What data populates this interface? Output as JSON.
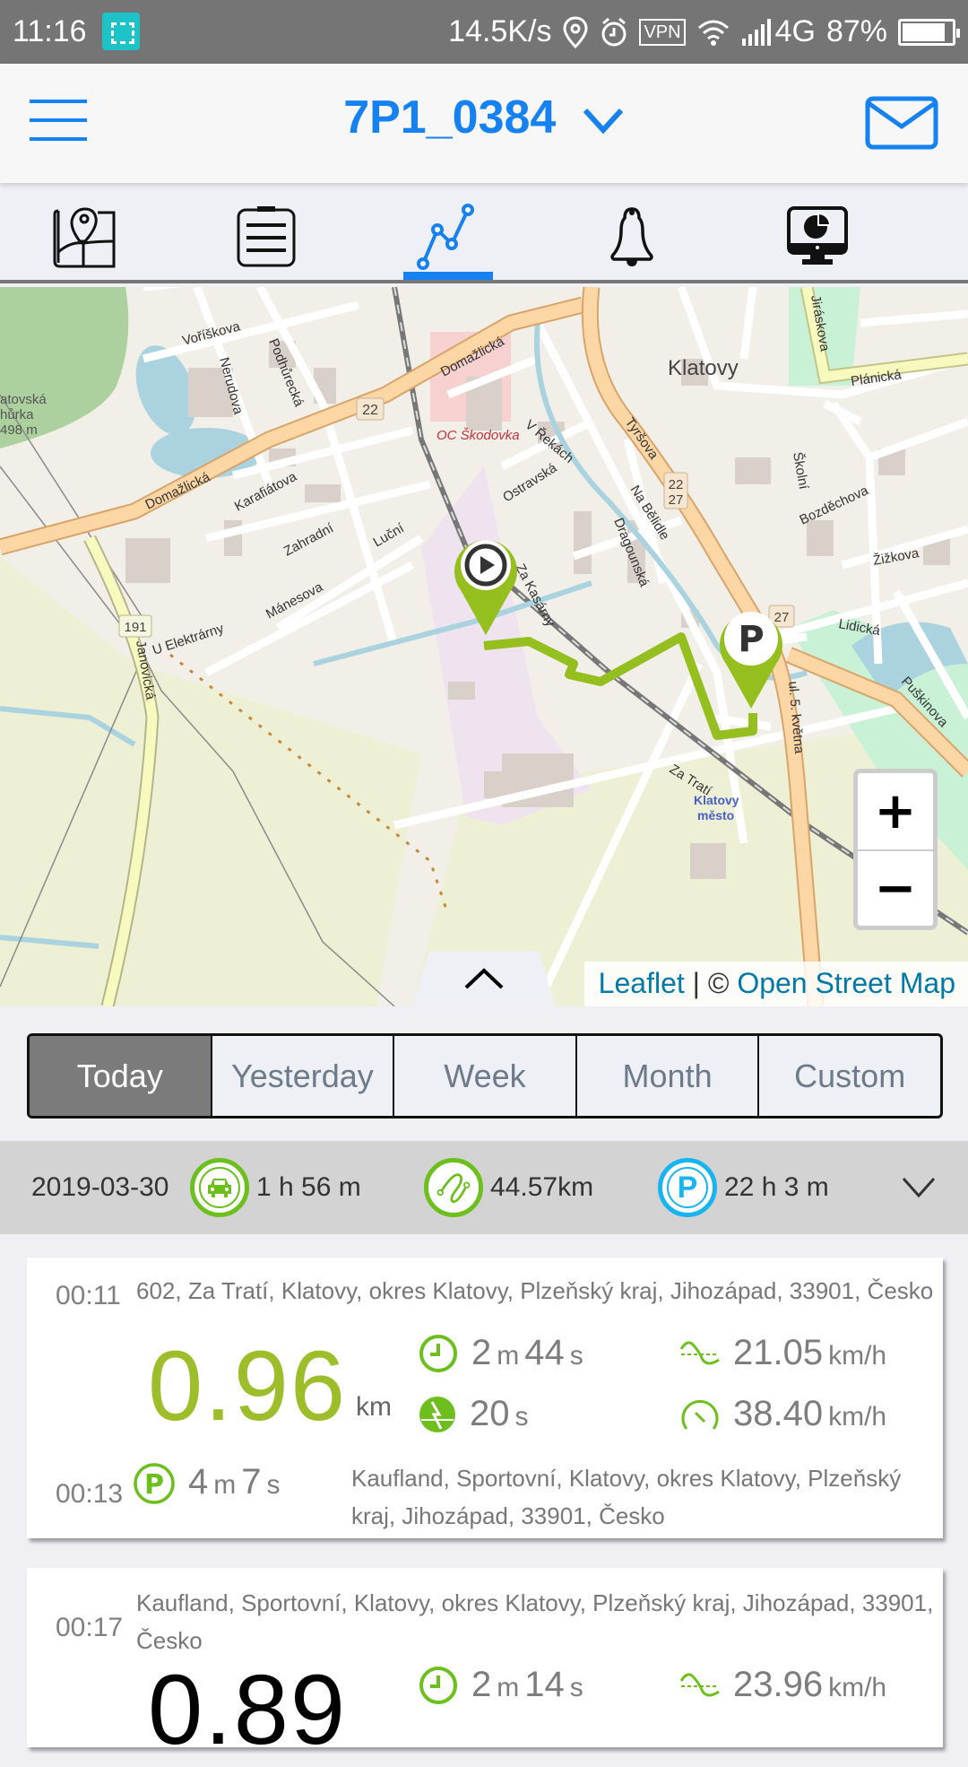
{
  "status_bar": {
    "time": "11:16",
    "net_speed": "14.5K/s",
    "vpn_label": "VPN",
    "network": "4G",
    "battery": "87%",
    "battery_level": 0.87
  },
  "header": {
    "title": "7P1_0384",
    "menu_icon": "hamburger-icon",
    "mail_icon": "envelope-icon"
  },
  "tabs": [
    {
      "name": "map",
      "icon": "map-pin-icon",
      "active": false
    },
    {
      "name": "list",
      "icon": "clipboard-list-icon",
      "active": false
    },
    {
      "name": "trips",
      "icon": "line-chart-icon",
      "active": true
    },
    {
      "name": "alerts",
      "icon": "bell-icon",
      "active": false
    },
    {
      "name": "reports",
      "icon": "monitor-pie-chart-icon",
      "active": false
    }
  ],
  "map": {
    "labels": {
      "city": "Klatovy",
      "poi": "OC Škodovka",
      "station": "Klatovy",
      "station2": "město",
      "hill1": "atovská",
      "hill2": "hůrka",
      "hill3": "498 m",
      "road_domazlicka": "Domažlická",
      "road_tyrsova": "Tyršova",
      "road_planicka": "Plánická",
      "road_jiraskova": "Jiráskova",
      "road_janovicka": "Janovická",
      "road_puskinova": "Puškinova",
      "road_dragounska": "Dragounská",
      "road_zatrati": "Za Tratí",
      "road_zkasarny": "Za Kasárny",
      "road_nabelidle": "Na Bělidle",
      "road_vrekach": "V Řekách",
      "road_ostravska": "Ostravská",
      "road_zahradni": "Zahradní",
      "road_manesova": "Mánesova",
      "road_vorískova": "Voříškova",
      "road_zizkova": "Žižkova",
      "road_lidicka": "Lidická",
      "road_bozdechova": "Bozděchova",
      "road_skolni": "Školní",
      "road_nerudova": "Nerudova",
      "road_podhurecka": "Podhůrecká",
      "road_uelektrarny": "U Elektrárny",
      "road_5kvetna": "ul. 5. května",
      "road_karafiatova": "Karafiátova",
      "road_lucni": "Luční",
      "shield_22": "22",
      "shield_27": "27",
      "shield_191": "191",
      "shield_2227": "22 27"
    },
    "start_marker_icon": "play-icon",
    "end_marker_icon": "parking-icon",
    "end_marker_label": "P",
    "zoom_in": "+",
    "zoom_out": "−",
    "attribution_leaflet": "Leaflet",
    "attribution_sep": " | © ",
    "attribution_osm": "Open Street Map"
  },
  "period_selector": {
    "options": [
      "Today",
      "Yesterday",
      "Week",
      "Month",
      "Custom"
    ],
    "selected": "Today"
  },
  "summary": {
    "date": "2019-03-30",
    "driving_time": "1 h 56 m",
    "distance": "44.57km",
    "parking_time": "22 h 3 m",
    "parking_icon_label": "P"
  },
  "trips": [
    {
      "start_time": "00:11",
      "start_address": "602, Za Tratí, Klatovy, okres Klatovy, Plzeňský kraj, Jihozápad, 33901, Česko",
      "distance": "0.96",
      "distance_unit": "km",
      "duration_m": "2",
      "duration_s": "44",
      "idle_s": "20",
      "avg_speed": "21.05",
      "max_speed": "38.40",
      "speed_unit": "km/h",
      "end_time": "00:13",
      "parking_m": "4",
      "parking_s": "7",
      "end_address": "Kaufland, Sportovní, Klatovy, okres Klatovy, Plzeňský kraj, Jihozápad, 33901, Česko",
      "label_m": "m",
      "label_s": "s"
    },
    {
      "start_time": "00:17",
      "start_address": "Kaufland, Sportovní, Klatovy, okres Klatovy, Plzeňský kraj, Jihozápad, 33901, Česko",
      "distance": "0.89",
      "duration_m": "2",
      "duration_s": "14",
      "avg_speed": "23.96",
      "speed_unit": "km/h",
      "label_m": "m",
      "label_s": "s"
    }
  ],
  "colors": {
    "accent_blue": "#1681f0",
    "trip_green": "#9dbe2a",
    "icon_green": "#6cbf1c",
    "parking_blue": "#18b4f0",
    "selected_segment": "#7b7b7b"
  }
}
